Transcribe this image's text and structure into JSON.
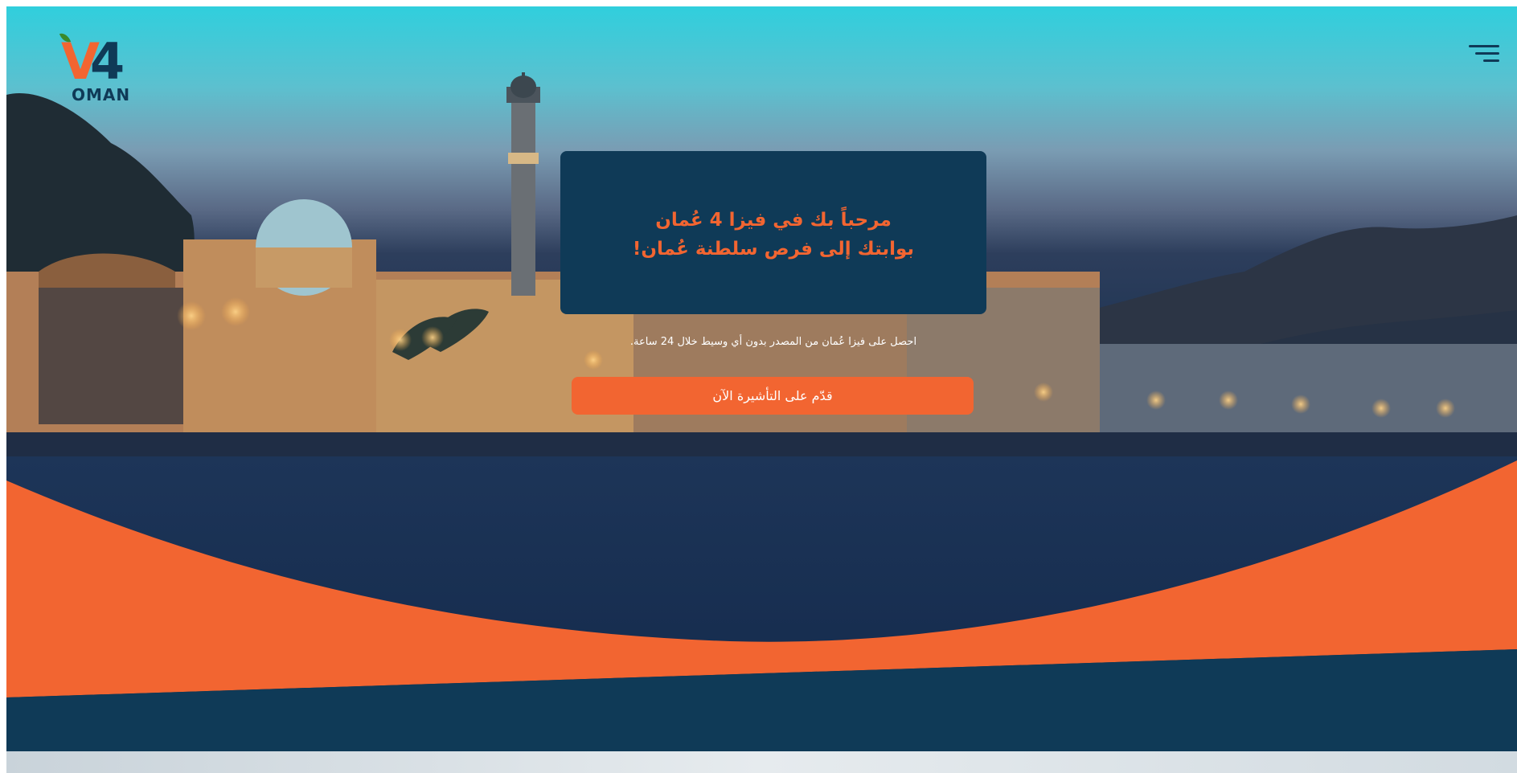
{
  "brand": {
    "logo_mark": "V4",
    "logo_word": "OMAN",
    "accent_color": "#f26531",
    "navy_color": "#0f3a57",
    "leaf_color": "#3a8a2b"
  },
  "header": {
    "menu_icon": "hamburger-menu-icon"
  },
  "hero": {
    "title_line_1": "مرحباً بك في فيزا 4 عُمان",
    "title_line_2": "بوابتك إلى فرص سلطنة عُمان!",
    "subtitle": "احصل على فيزا عُمان من المصدر بدون أي وسيط خلال 24 ساعة.",
    "cta_label": "قدّم على التأشيرة الآن"
  }
}
